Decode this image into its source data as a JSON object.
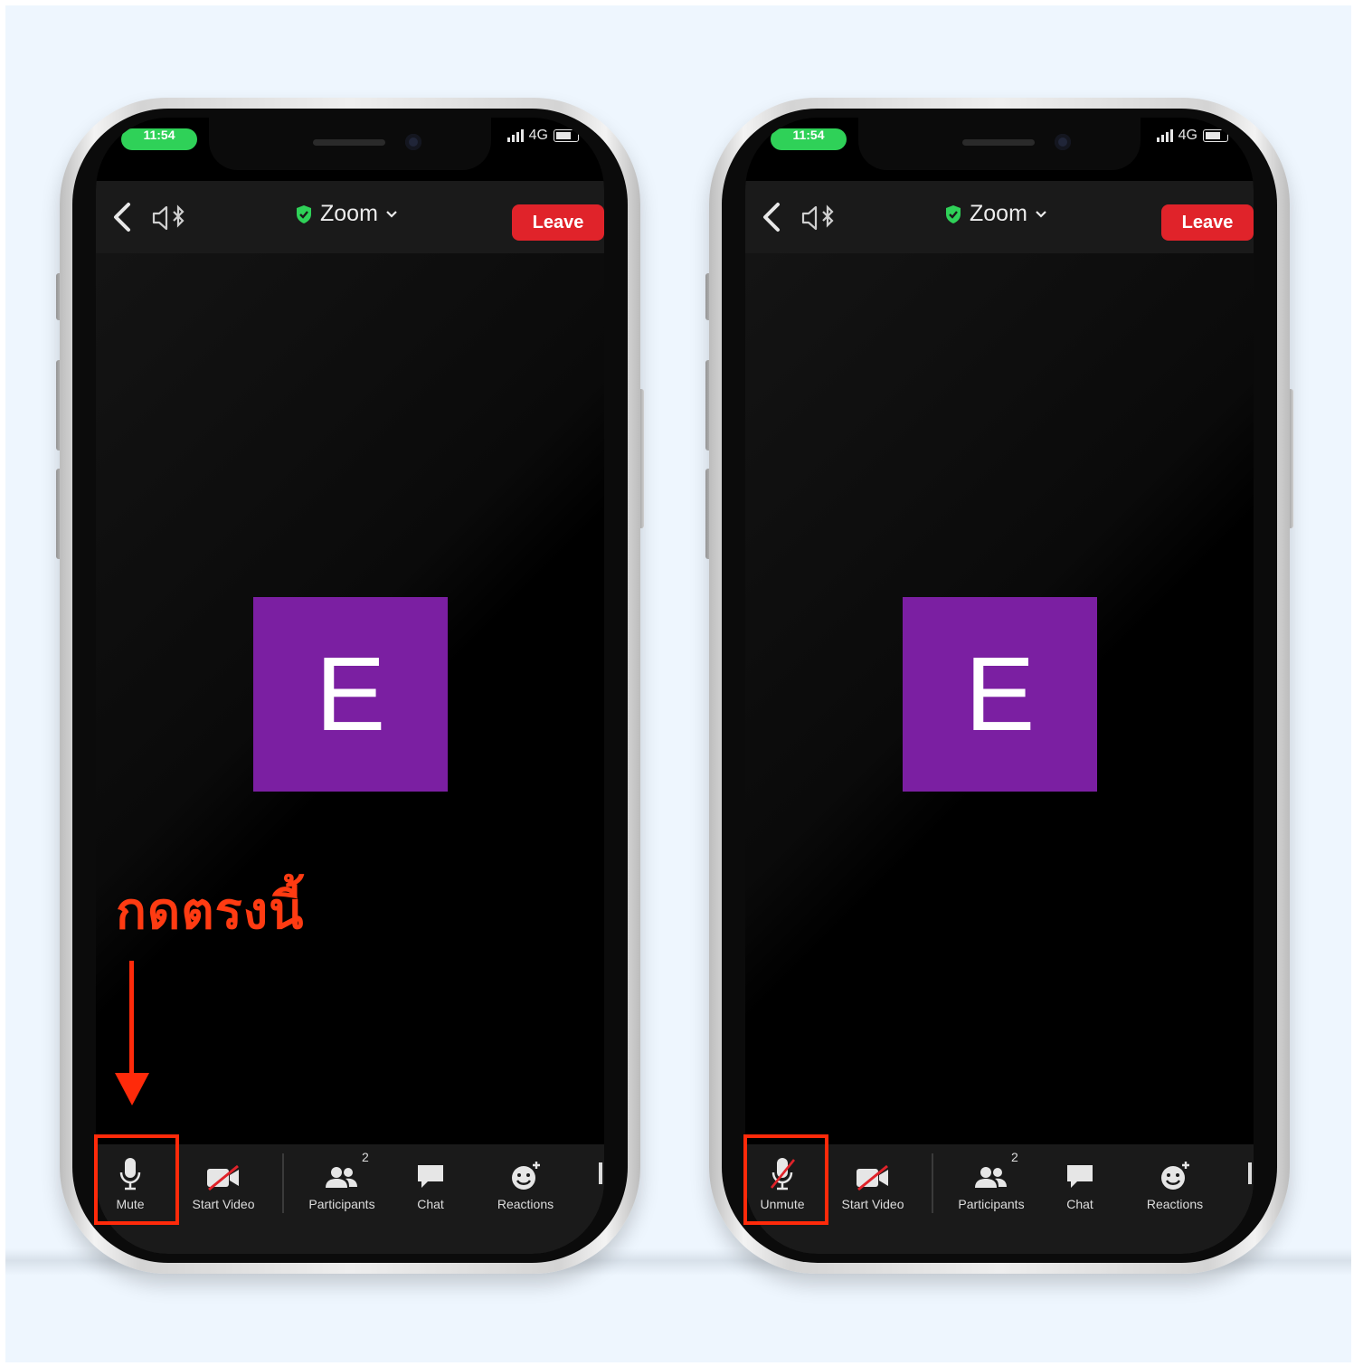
{
  "phones": [
    {
      "status_time": "11:54",
      "status_network": "4G",
      "meeting_title": "Zoom",
      "leave_label": "Leave",
      "avatar_letter": "E",
      "toolbar": {
        "audio_label": "Mute",
        "audio_muted": false,
        "video_label": "Start Video",
        "participants_label": "Participants",
        "participants_count": "2",
        "chat_label": "Chat",
        "reactions_label": "Reactions"
      }
    },
    {
      "status_time": "11:54",
      "status_network": "4G",
      "meeting_title": "Zoom",
      "leave_label": "Leave",
      "avatar_letter": "E",
      "toolbar": {
        "audio_label": "Unmute",
        "audio_muted": true,
        "video_label": "Start Video",
        "participants_label": "Participants",
        "participants_count": "2",
        "chat_label": "Chat",
        "reactions_label": "Reactions"
      }
    }
  ],
  "annotation": {
    "instruction_text": "กดตรงนี้"
  },
  "colors": {
    "background": "#eef6fe",
    "leave_red": "#e0232a",
    "avatar_purple": "#7b1fa2",
    "highlight_red": "#ff2a0a",
    "status_green": "#2fd158",
    "toolbar": "#1a1a1a"
  },
  "icons": {
    "back": "chevron-left-icon",
    "audio_output": "speaker-bluetooth-icon",
    "secure": "shield-check-icon",
    "title_dropdown": "chevron-down-icon",
    "mute": "microphone-icon",
    "unmute": "microphone-muted-icon",
    "video": "video-off-icon",
    "participants": "participants-icon",
    "chat": "chat-bubble-icon",
    "reactions": "reaction-emoji-icon"
  }
}
